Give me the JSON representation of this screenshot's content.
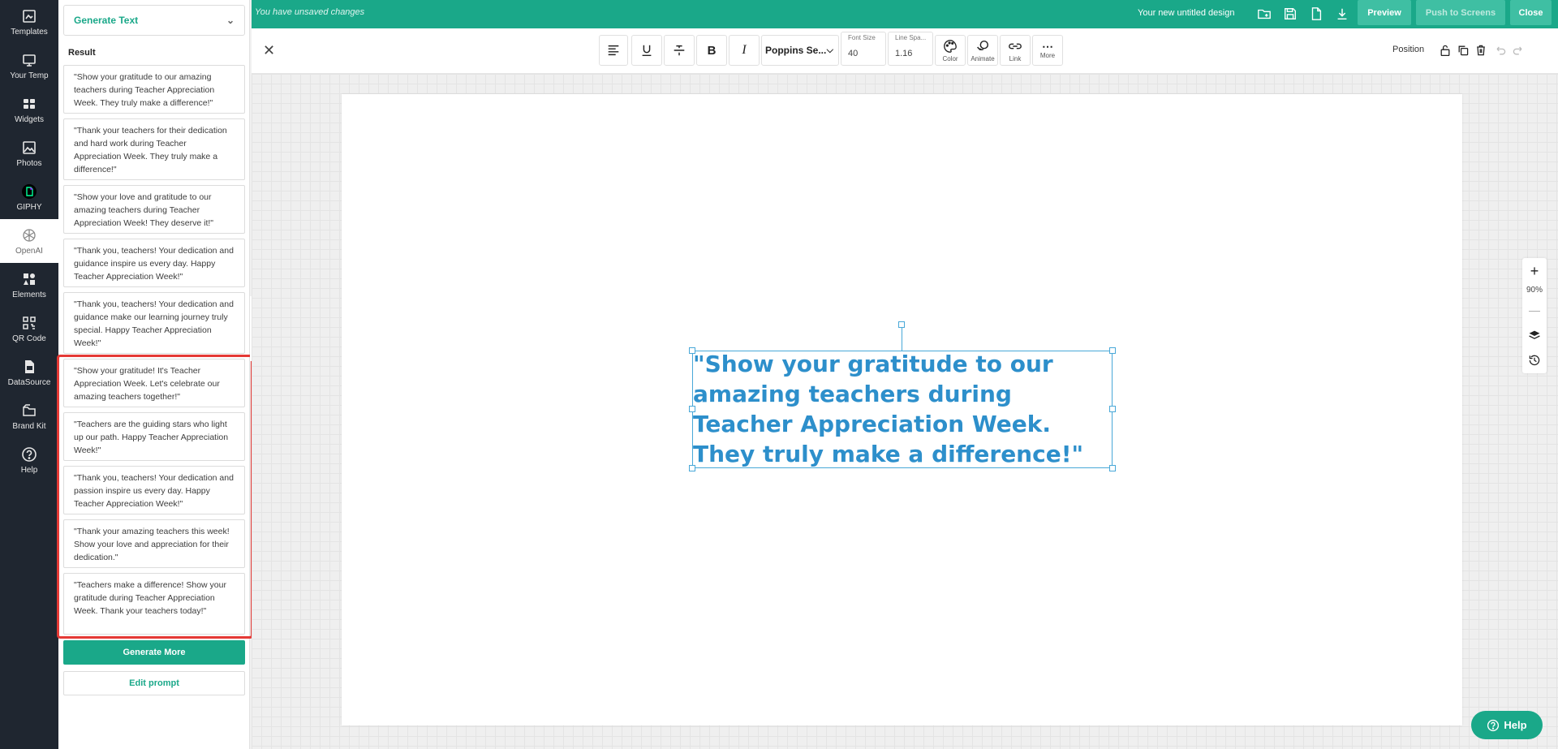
{
  "rail": {
    "items": [
      {
        "label": "Templates",
        "icon": "templates-icon"
      },
      {
        "label": "Your Temp",
        "icon": "your-templates-icon"
      },
      {
        "label": "Widgets",
        "icon": "widgets-icon"
      },
      {
        "label": "Photos",
        "icon": "photos-icon"
      },
      {
        "label": "GIPHY",
        "icon": "giphy-icon"
      },
      {
        "label": "OpenAI",
        "icon": "openai-icon"
      },
      {
        "label": "Elements",
        "icon": "elements-icon"
      },
      {
        "label": "QR Code",
        "icon": "qr-code-icon"
      },
      {
        "label": "DataSource",
        "icon": "datasource-icon"
      },
      {
        "label": "Brand Kit",
        "icon": "brand-kit-icon"
      },
      {
        "label": "Help",
        "icon": "help-icon"
      }
    ],
    "active": "OpenAI"
  },
  "panel": {
    "dropdown_label": "Generate Text",
    "result_label": "Result",
    "results": [
      "\"Show your gratitude to our amazing teachers during Teacher Appreciation Week. They truly make a difference!\"",
      "\"Thank your teachers for their dedication and hard work during Teacher Appreciation Week. They truly make a difference!\"",
      "\"Show your love and gratitude to our amazing teachers during Teacher Appreciation Week! They deserve it!\"",
      "\"Thank you, teachers! Your dedication and guidance inspire us every day. Happy Teacher Appreciation Week!\"",
      "\"Thank you, teachers! Your dedication and guidance make our learning journey truly special. Happy Teacher Appreciation Week!\"",
      "\"Show your gratitude! It's Teacher Appreciation Week. Let's celebrate our amazing teachers together!\"",
      "\"Teachers are the guiding stars who light up our path. Happy Teacher Appreciation Week!\"",
      "\"Thank you, teachers! Your dedication and passion inspire us every day. Happy Teacher Appreciation Week!\"",
      "\"Thank your amazing teachers this week! Show your love and appreciation for their dedication.\"",
      "\"Teachers make a difference! Show your gratitude during Teacher Appreciation Week. Thank your teachers today!\""
    ],
    "generate_more": "Generate More",
    "edit_prompt": "Edit prompt"
  },
  "topbar": {
    "unsaved": "You have unsaved changes",
    "title": "Your new untitled design",
    "preview": "Preview",
    "push": "Push to Screens",
    "close": "Close"
  },
  "toolbar": {
    "font_family": "Poppins Se...",
    "font_size_label": "Font Size",
    "font_size": "40",
    "line_spacing_label": "Line Spa...",
    "line_spacing": "1.16",
    "color": "Color",
    "animate": "Animate",
    "link": "Link",
    "more": "More",
    "position": "Position"
  },
  "canvas": {
    "text": "\"Show your gratitude to our amazing teachers during Teacher Appreciation Week. They truly make a difference!\"",
    "text_color": "#2d8fcb",
    "zoom": "90%"
  },
  "help_button": "Help",
  "colors": {
    "accent": "#1aa889",
    "rail_bg": "#1f2630",
    "highlight": "#e53935"
  }
}
